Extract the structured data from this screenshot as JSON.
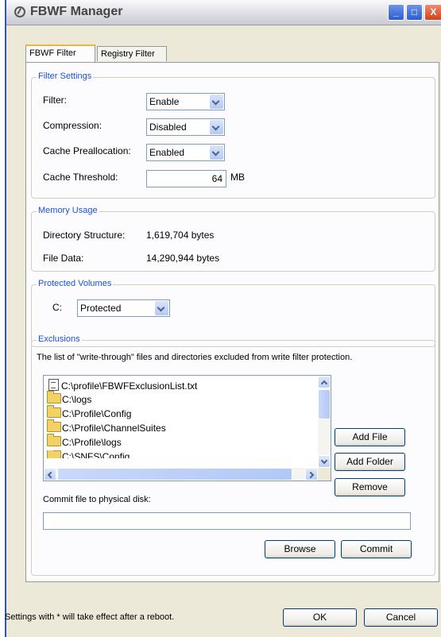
{
  "window": {
    "title": "FBWF Manager",
    "minimize": "_",
    "maximize": "□",
    "close": "X"
  },
  "tabs": [
    {
      "label": "FBWF Filter"
    },
    {
      "label": "Registry Filter"
    }
  ],
  "filter_settings": {
    "legend": "Filter Settings",
    "filter_label": "Filter:",
    "filter_value": "Enable",
    "compression_label": "Compression:",
    "compression_value": "Disabled",
    "cache_prealloc_label": "Cache Preallocation:",
    "cache_prealloc_value": "Enabled",
    "cache_threshold_label": "Cache Threshold:",
    "cache_threshold_value": "64",
    "cache_threshold_unit": "MB"
  },
  "memory_usage": {
    "legend": "Memory Usage",
    "directory_label": "Directory Structure:",
    "directory_value": "1,619,704 bytes",
    "filedata_label": "File Data:",
    "filedata_value": "14,290,944 bytes"
  },
  "protected_volumes": {
    "legend": "Protected Volumes",
    "drive_label": "C:",
    "drive_value": "Protected"
  },
  "exclusions": {
    "legend": "Exclusions",
    "description": "The list of \"write-through\" files and directories excluded from write filter protection.",
    "items": [
      {
        "type": "file",
        "path": "C:\\profile\\FBWFExclusionList.txt"
      },
      {
        "type": "folder",
        "path": "C:\\logs"
      },
      {
        "type": "folder",
        "path": "C:\\Profile\\Config"
      },
      {
        "type": "folder",
        "path": "C:\\Profile\\ChannelSuites"
      },
      {
        "type": "folder",
        "path": "C:\\Profile\\logs"
      },
      {
        "type": "folder",
        "path": "C:\\SNFS\\Config"
      }
    ],
    "add_file_label": "Add File",
    "add_folder_label": "Add Folder",
    "remove_label": "Remove",
    "commit_label": "Commit file to physical disk:",
    "commit_value": "",
    "browse_label": "Browse",
    "commit_button_label": "Commit"
  },
  "footer": {
    "note": "Settings with * will take effect after a reboot.",
    "ok_label": "OK",
    "cancel_label": "Cancel"
  }
}
